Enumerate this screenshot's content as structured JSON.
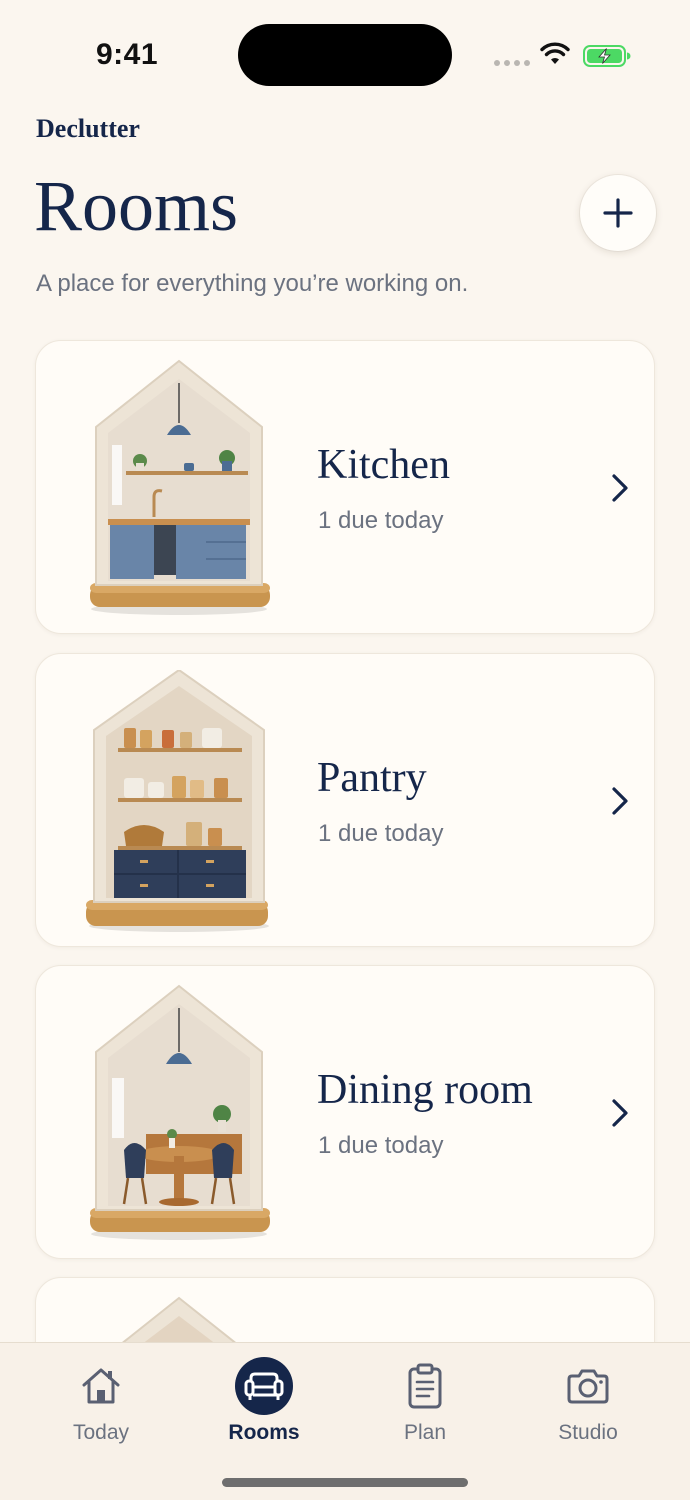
{
  "status_bar": {
    "time": "9:41"
  },
  "header": {
    "app_label": "Declutter",
    "title": "Rooms",
    "subtitle": "A place for everything you’re working on.",
    "add_icon": "plus-icon"
  },
  "rooms": [
    {
      "name": "Kitchen",
      "status": "1 due today",
      "illustration": "kitchen-house-illustration"
    },
    {
      "name": "Pantry",
      "status": "1 due today",
      "illustration": "pantry-house-illustration"
    },
    {
      "name": "Dining room",
      "status": "1 due today",
      "illustration": "dining-room-house-illustration"
    },
    {
      "name": "",
      "status": "",
      "illustration": "house-illustration"
    }
  ],
  "tab_bar": {
    "tabs": [
      {
        "label": "Today",
        "icon": "house-icon",
        "active": false
      },
      {
        "label": "Rooms",
        "icon": "sofa-icon",
        "active": true
      },
      {
        "label": "Plan",
        "icon": "clipboard-icon",
        "active": false
      },
      {
        "label": "Studio",
        "icon": "camera-icon",
        "active": false
      }
    ]
  },
  "colors": {
    "background": "#FBF6EF",
    "navy": "#15264A",
    "muted_text": "#6B7280",
    "card": "#FFFCF7",
    "battery_green": "#4CD964"
  }
}
